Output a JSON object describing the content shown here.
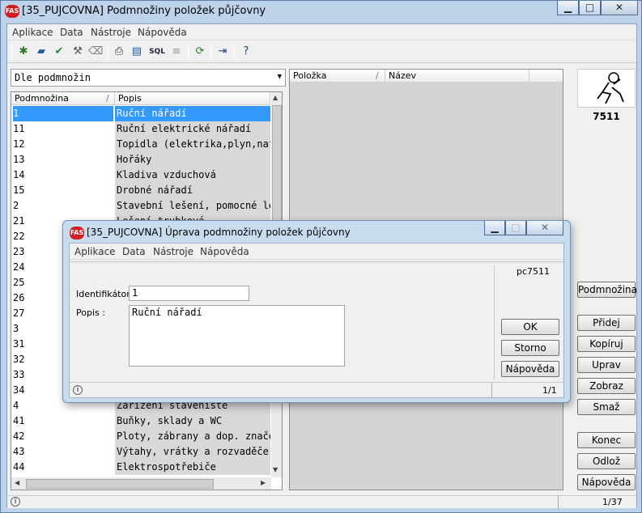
{
  "window": {
    "app_icon": "FAS",
    "title": "[35_PUJCOVNA] Podmnožiny položek půjčovny",
    "minimize": "▁",
    "maximize": "□",
    "close": "✕"
  },
  "menu": [
    "Aplikace",
    "Data",
    "Nástroje",
    "Nápověda"
  ],
  "toolbar": {
    "icons": [
      "new-icon",
      "edit-icon",
      "check-icon",
      "tools-icon",
      "eraser-icon",
      "print-icon",
      "export-icon",
      "sql-icon",
      "list-icon",
      "refresh-icon",
      "exit-icon",
      "help-icon"
    ],
    "sql_label": "SQL"
  },
  "filter_combo": {
    "value": "Dle podmnožin"
  },
  "left_grid": {
    "col1": "Podmnožina",
    "col2": "Popis",
    "rows": [
      {
        "id": "1",
        "desc": "Ruční nářadí",
        "selected": true
      },
      {
        "id": "11",
        "desc": "Ruční elektrické nářadí"
      },
      {
        "id": "12",
        "desc": "Topidla (elektrika,plyn,naf"
      },
      {
        "id": "13",
        "desc": "Hořáky"
      },
      {
        "id": "14",
        "desc": "Kladiva vzduchová"
      },
      {
        "id": "15",
        "desc": "Drobné nářadí"
      },
      {
        "id": "2",
        "desc": "Stavební lešení, pomocné le"
      },
      {
        "id": "21",
        "desc": "Lešení trubkové"
      },
      {
        "id": "22",
        "desc": ""
      },
      {
        "id": "23",
        "desc": ""
      },
      {
        "id": "24",
        "desc": ""
      },
      {
        "id": "25",
        "desc": ""
      },
      {
        "id": "26",
        "desc": ""
      },
      {
        "id": "27",
        "desc": ""
      },
      {
        "id": "3",
        "desc": ""
      },
      {
        "id": "31",
        "desc": ""
      },
      {
        "id": "32",
        "desc": ""
      },
      {
        "id": "33",
        "desc": ""
      },
      {
        "id": "34",
        "desc": ""
      },
      {
        "id": "4",
        "desc": "Zařízení staveniště"
      },
      {
        "id": "41",
        "desc": "Buňky, sklady a WC"
      },
      {
        "id": "42",
        "desc": "Ploty, zábrany a dop. znače"
      },
      {
        "id": "43",
        "desc": "Výtahy, vrátky a rozvaděče"
      },
      {
        "id": "44",
        "desc": "Elektrospotřebiče"
      }
    ]
  },
  "right_grid": {
    "col1": "Položka",
    "col2": "Název"
  },
  "logo_number": "7511",
  "right_buttons": {
    "podmnozina": "Podmnožina",
    "pridej": "Přidej",
    "kopiruj": "Kopíruj",
    "uprav": "Uprav",
    "zobraz": "Zobraz",
    "smaz": "Smaž",
    "konec": "Konec",
    "odloz": "Odlož",
    "napoveda": "Nápověda"
  },
  "status": {
    "info": "i",
    "counter": "1/37"
  },
  "dialog": {
    "title": "[35_PUJCOVNA] Úprava podmnožiny položek půjčovny",
    "menu": [
      "Aplikace",
      "Data",
      "Nástroje",
      "Nápověda"
    ],
    "code": "pc7511",
    "identifikator_label": "Identifikátor :",
    "identifikator_value": "1",
    "popis_label": "Popis :",
    "popis_value": "Ruční nářadí",
    "ok": "OK",
    "storno": "Storno",
    "napoveda": "Nápověda",
    "status_counter": "1/1"
  }
}
